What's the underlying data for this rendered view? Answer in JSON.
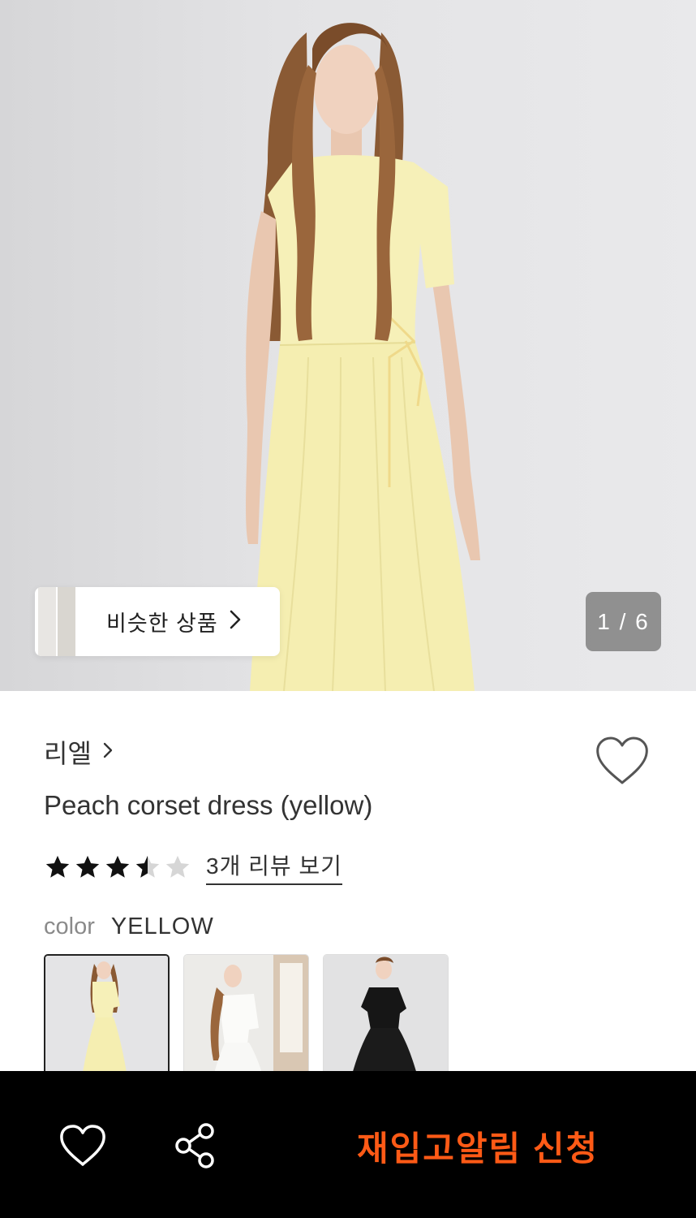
{
  "hero": {
    "image": "model-yellow-dress-photo",
    "similar_label": "비슷한 상품",
    "counter": "1 / 6"
  },
  "product": {
    "brand": "리엘",
    "title": "Peach corset dress (yellow)",
    "rating": 3.5,
    "rating_max": 5,
    "review_link": "3개 리뷰 보기",
    "color_label": "color",
    "color_value": "YELLOW",
    "swatches": [
      "yellow-dress-swatch",
      "white-dress-swatch",
      "black-dress-swatch"
    ]
  },
  "bottom_bar": {
    "restock_label": "재입고알림 신청"
  },
  "colors": {
    "accent": "#ff5a16",
    "bar_bg": "#000000",
    "dress_yellow": "#f5efb3"
  },
  "icons": [
    "chevron-right-icon",
    "heart-outline-icon",
    "star-icon",
    "share-icon"
  ]
}
